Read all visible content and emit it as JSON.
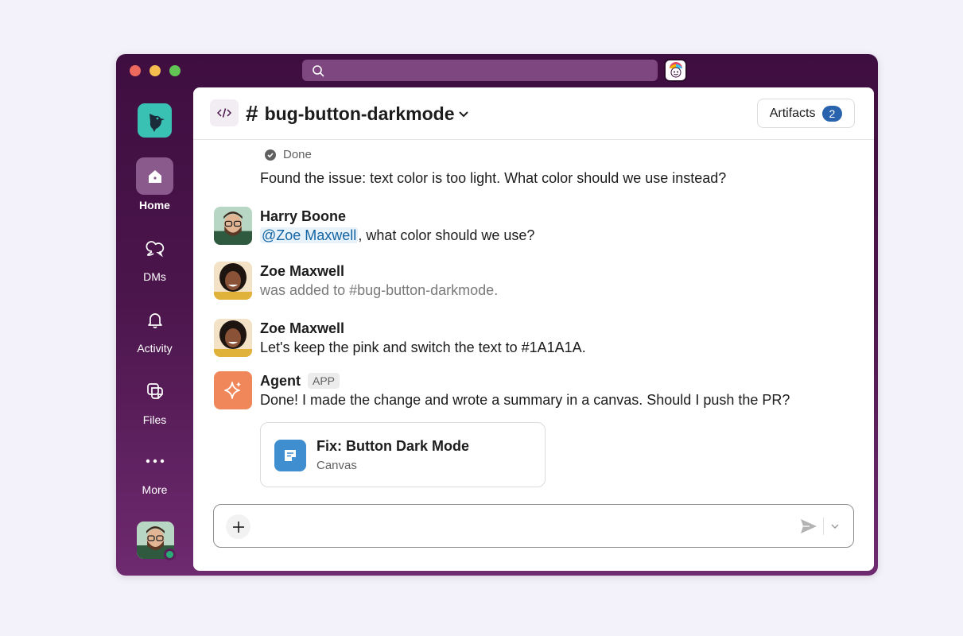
{
  "window": {
    "search": {
      "placeholder": "",
      "value": ""
    }
  },
  "rail": {
    "items": [
      {
        "label": "Home",
        "icon": "home-icon",
        "active": true
      },
      {
        "label": "DMs",
        "icon": "dms-icon"
      },
      {
        "label": "Activity",
        "icon": "bell-icon"
      },
      {
        "label": "Files",
        "icon": "files-icon"
      },
      {
        "label": "More",
        "icon": "more-icon"
      }
    ]
  },
  "channel": {
    "hash": "#",
    "name": "bug-button-darkmode",
    "artifacts_label": "Artifacts",
    "artifacts_count": "2"
  },
  "messages": {
    "done_label": "Done",
    "first_text": "Found the issue: text color is too light. What color should we use instead?",
    "harry": {
      "name": "Harry Boone",
      "mention": "@Zoe Maxwell",
      "text": ", what color should we use?"
    },
    "zoe_join": {
      "name": "Zoe Maxwell",
      "text": "was added to #bug-button-darkmode."
    },
    "zoe": {
      "name": "Zoe Maxwell",
      "text": "Let's keep the pink and switch the text to #1A1A1A."
    },
    "agent": {
      "name": "Agent",
      "tag": "APP",
      "text": "Done! I made the change and wrote a summary in a canvas. Should I push the PR?"
    },
    "canvas": {
      "title": "Fix: Button Dark Mode",
      "subtitle": "Canvas"
    }
  },
  "composer": {
    "placeholder": "",
    "value": ""
  },
  "colors": {
    "aubergine": "#4a154b",
    "accent_blue": "#2a63ad",
    "mention_blue": "#1264a3",
    "presence_green": "#2bac76",
    "agent_orange": "#f0875a"
  }
}
